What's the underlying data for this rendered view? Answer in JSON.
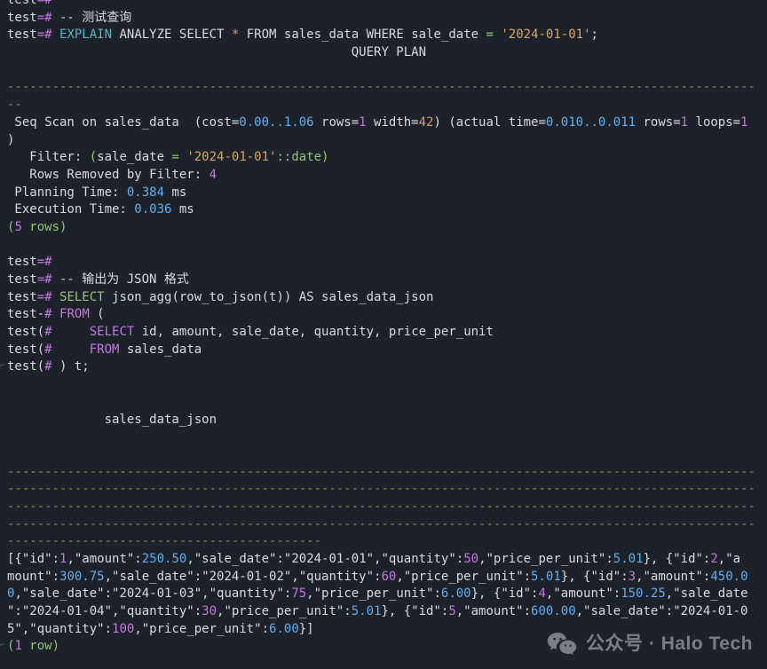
{
  "colors": {
    "background": "#1c212a",
    "fg": "#d7dbe0",
    "magenta": "#c678dd",
    "blue": "#61afef",
    "cyan": "#56b6c2",
    "green": "#98c379",
    "orange": "#d19a66",
    "yellow": "#d9a85e",
    "olive": "#8e9150",
    "gutter": "#59616d",
    "watermark": "#83878f"
  },
  "watermark": {
    "text": "公众号 · Halo Tech",
    "icon": "wechat-icon"
  },
  "terminal": {
    "prompt": "test=#",
    "lines": [
      {
        "segments": [
          [
            "fg",
            "test"
          ],
          [
            "magenta",
            "=#"
          ]
        ]
      },
      {
        "segments": [
          [
            "fg",
            "test"
          ],
          [
            "magenta",
            "=#"
          ],
          [
            "fg",
            " -- 测试查询"
          ]
        ]
      },
      {
        "segments": [
          [
            "fg",
            "test"
          ],
          [
            "magenta",
            "=#"
          ],
          [
            "fg",
            " "
          ],
          [
            "cyan",
            "EXPLAIN"
          ],
          [
            "fg",
            " ANALYZE SELECT "
          ],
          [
            "orange",
            "*"
          ],
          [
            "fg",
            " FROM sales_data WHERE sale_date "
          ],
          [
            "green",
            "="
          ],
          [
            "fg",
            " "
          ],
          [
            "yellow",
            "'2024-01-01'"
          ],
          [
            "fg",
            ";"
          ]
        ]
      },
      {
        "segments": [
          [
            "fg",
            " ",
            46
          ],
          [
            "fg",
            "QUERY PLAN"
          ]
        ]
      },
      {
        "segments": []
      },
      {
        "segments": [
          [
            "olive",
            "-",
            100
          ]
        ]
      },
      {
        "segments": [
          [
            "olive",
            "--"
          ]
        ]
      },
      {
        "segments": [
          [
            "fg",
            " Seq Scan on sales_data  (cost="
          ],
          [
            "blue",
            "0.00..1.06"
          ],
          [
            "fg",
            " rows="
          ],
          [
            "magenta",
            "1"
          ],
          [
            "fg",
            " width="
          ],
          [
            "orange",
            "42"
          ],
          [
            "fg",
            ") (actual time="
          ],
          [
            "blue",
            "0.010..0.011"
          ],
          [
            "fg",
            " rows="
          ],
          [
            "magenta",
            "1"
          ],
          [
            "fg",
            " loops="
          ],
          [
            "magenta",
            "1"
          ]
        ]
      },
      {
        "segments": [
          [
            "fg",
            ")"
          ]
        ]
      },
      {
        "segments": [
          [
            "fg",
            "   Filter: "
          ],
          [
            "green",
            "("
          ],
          [
            "fg",
            "sale_date "
          ],
          [
            "green",
            "="
          ],
          [
            "fg",
            " "
          ],
          [
            "yellow",
            "'2024-01-01'"
          ],
          [
            "green",
            "::date)"
          ]
        ]
      },
      {
        "segments": [
          [
            "fg",
            "   Rows Removed by Filter: "
          ],
          [
            "magenta",
            "4"
          ]
        ]
      },
      {
        "segments": [
          [
            "fg",
            " Planning Time: "
          ],
          [
            "blue",
            "0.384"
          ],
          [
            "fg",
            " ms"
          ]
        ]
      },
      {
        "segments": [
          [
            "fg",
            " Execution Time: "
          ],
          [
            "blue",
            "0.036"
          ],
          [
            "fg",
            " ms"
          ]
        ]
      },
      {
        "segments": [
          [
            "green",
            "("
          ],
          [
            "magenta",
            "5"
          ],
          [
            "green",
            " rows)"
          ]
        ]
      },
      {
        "segments": []
      },
      {
        "segments": [
          [
            "fg",
            "test"
          ],
          [
            "magenta",
            "=#"
          ]
        ]
      },
      {
        "segments": [
          [
            "fg",
            "test"
          ],
          [
            "magenta",
            "=#"
          ],
          [
            "fg",
            " -- 输出为 JSON 格式"
          ]
        ]
      },
      {
        "segments": [
          [
            "fg",
            "test"
          ],
          [
            "magenta",
            "=#"
          ],
          [
            "fg",
            " "
          ],
          [
            "green",
            "SELECT"
          ],
          [
            "fg",
            " json_agg(row_to_json(t)) AS sales_data_json"
          ]
        ]
      },
      {
        "segments": [
          [
            "fg",
            "test-"
          ],
          [
            "magenta",
            "#"
          ],
          [
            "fg",
            " "
          ],
          [
            "magenta",
            "FROM"
          ],
          [
            "fg",
            " ("
          ]
        ]
      },
      {
        "segments": [
          [
            "fg",
            "test("
          ],
          [
            "magenta",
            "#"
          ],
          [
            "fg",
            " ",
            5
          ],
          [
            "magenta",
            "SELECT"
          ],
          [
            "fg",
            " id, amount, sale_date, quantity, price_per_unit"
          ]
        ]
      },
      {
        "segments": [
          [
            "fg",
            "test("
          ],
          [
            "magenta",
            "#"
          ],
          [
            "fg",
            " ",
            5
          ],
          [
            "magenta",
            "FROM"
          ],
          [
            "fg",
            " sales_data"
          ]
        ]
      },
      {
        "gutter": "⌐",
        "segments": [
          [
            "fg",
            "test("
          ],
          [
            "magenta",
            "#"
          ],
          [
            "fg",
            " ) t;"
          ]
        ]
      },
      {
        "segments": []
      },
      {
        "segments": []
      },
      {
        "segments": [
          [
            "fg",
            " ",
            13
          ],
          [
            "fg",
            "sales_data_json"
          ]
        ]
      },
      {
        "segments": []
      },
      {
        "segments": []
      },
      {
        "segments": [
          [
            "olive",
            "-",
            100
          ]
        ]
      },
      {
        "segments": [
          [
            "olive",
            "-",
            100
          ]
        ]
      },
      {
        "segments": [
          [
            "olive",
            "-",
            100
          ]
        ]
      },
      {
        "segments": [
          [
            "olive",
            "-",
            100
          ]
        ]
      },
      {
        "segments": [
          [
            "olive",
            "-",
            42
          ]
        ]
      },
      {
        "segments": [
          [
            "fg",
            "[{\"id\":"
          ],
          [
            "magenta",
            "1"
          ],
          [
            "fg",
            ",\"amount\":"
          ],
          [
            "blue",
            "250.50"
          ],
          [
            "fg",
            ",\"sale_date\":\"2024-01-01\",\"quantity\":"
          ],
          [
            "magenta",
            "50"
          ],
          [
            "fg",
            ",\"price_per_unit\":"
          ],
          [
            "blue",
            "5.01"
          ],
          [
            "fg",
            "}, {\"id\":"
          ],
          [
            "magenta",
            "2"
          ],
          [
            "fg",
            ",\"a"
          ]
        ]
      },
      {
        "segments": [
          [
            "fg",
            "mount\":"
          ],
          [
            "blue",
            "300.75"
          ],
          [
            "fg",
            ",\"sale_date\":\"2024-01-02\",\"quantity\":"
          ],
          [
            "magenta",
            "60"
          ],
          [
            "fg",
            ",\"price_per_unit\":"
          ],
          [
            "blue",
            "5.01"
          ],
          [
            "fg",
            "}, {\"id\":"
          ],
          [
            "magenta",
            "3"
          ],
          [
            "fg",
            ",\"amount\":"
          ],
          [
            "blue",
            "450.0"
          ]
        ]
      },
      {
        "segments": [
          [
            "blue",
            "0"
          ],
          [
            "fg",
            ",\"sale_date\":\"2024-01-03\",\"quantity\":"
          ],
          [
            "magenta",
            "75"
          ],
          [
            "fg",
            ",\"price_per_unit\":"
          ],
          [
            "blue",
            "6.00"
          ],
          [
            "fg",
            "}, {\"id\":"
          ],
          [
            "magenta",
            "4"
          ],
          [
            "fg",
            ",\"amount\":"
          ],
          [
            "blue",
            "150.25"
          ],
          [
            "fg",
            ",\"sale_date"
          ]
        ]
      },
      {
        "segments": [
          [
            "fg",
            "\":\"2024-01-04\",\"quantity\":"
          ],
          [
            "magenta",
            "30"
          ],
          [
            "fg",
            ",\"price_per_unit\":"
          ],
          [
            "blue",
            "5.01"
          ],
          [
            "fg",
            "}, {\"id\":"
          ],
          [
            "magenta",
            "5"
          ],
          [
            "fg",
            ",\"amount\":"
          ],
          [
            "blue",
            "600.00"
          ],
          [
            "fg",
            ",\"sale_date\":\"2024-01-0"
          ]
        ]
      },
      {
        "segments": [
          [
            "fg",
            "5\",\"quantity\":"
          ],
          [
            "magenta",
            "100"
          ],
          [
            "fg",
            ",\"price_per_unit\":"
          ],
          [
            "blue",
            "6.00"
          ],
          [
            "fg",
            "}]"
          ]
        ]
      },
      {
        "gutter": "⌐",
        "segments": [
          [
            "green",
            "("
          ],
          [
            "magenta",
            "1"
          ],
          [
            "green",
            " row)"
          ]
        ]
      }
    ]
  }
}
